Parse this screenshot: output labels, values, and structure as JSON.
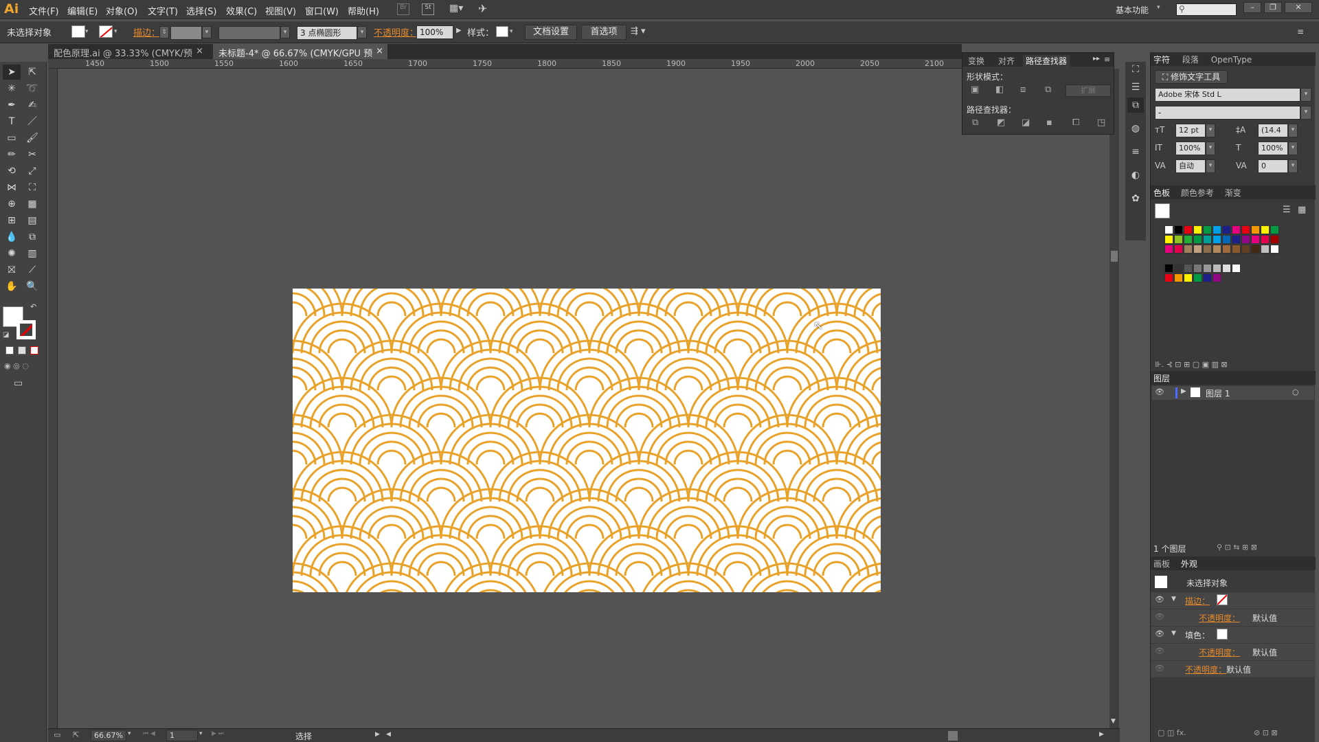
{
  "app": {
    "logo": "Ai"
  },
  "menu": [
    "文件(F)",
    "编辑(E)",
    "对象(O)",
    "文字(T)",
    "选择(S)",
    "效果(C)",
    "视图(V)",
    "窗口(W)",
    "帮助(H)"
  ],
  "menu_right": {
    "workspace": "基本功能",
    "search_placeholder": ""
  },
  "window_buttons": [
    "–",
    "❐",
    "✕"
  ],
  "control": {
    "selection": "未选择对象",
    "stroke_label": "描边：",
    "stroke_weight": "",
    "brush": "3 点椭圆形",
    "opacity_label": "不透明度：",
    "opacity_value": "100%",
    "style_label": "样式：",
    "doc_setup": "文档设置",
    "preferences": "首选项"
  },
  "tabs": [
    {
      "label": "配色原理.ai @ 33.33% (CMYK/预览)",
      "close": "×"
    },
    {
      "label": "未标题-4* @ 66.67% (CMYK/GPU 预览)",
      "close": "×"
    }
  ],
  "ruler": [
    "1450",
    "1500",
    "1550",
    "1600",
    "1650",
    "1700",
    "1750",
    "1800",
    "1850",
    "1900",
    "1950",
    "2000",
    "2050",
    "2100"
  ],
  "pathfinder": {
    "tabs": [
      "变换",
      "对齐",
      "路径查找器"
    ],
    "shape_modes": "形状模式：",
    "expand": "扩展",
    "pathfinders": "路径查找器："
  },
  "char_panel": {
    "tabs": [
      "字符",
      "段落",
      "OpenType"
    ],
    "touch_tool": "修饰文字工具",
    "font": "Adobe 宋体 Std L",
    "style": "-",
    "size": "12 pt",
    "leading": "(14.4",
    "vscale": "100%",
    "hscale": "100%",
    "kerning": "自动",
    "tracking": "0"
  },
  "swatch_panel": {
    "tabs": [
      "色板",
      "颜色参考",
      "渐变"
    ],
    "row1": [
      "#ffffff",
      "#000000",
      "#e60012",
      "#fff100",
      "#009944",
      "#00a0e9",
      "#1d2088",
      "#e4007f",
      "#e60012",
      "#f39800",
      "#fff100",
      "#009944"
    ],
    "row2": [
      "#fff100",
      "#8fc31f",
      "#22ac38",
      "#009944",
      "#009e96",
      "#00a0e9",
      "#0068b7",
      "#1d2088",
      "#920783",
      "#e4007f",
      "#e5004f",
      "#a40000"
    ],
    "row3": [
      "#e4007f",
      "#e5004f",
      "#a0805c",
      "#c0a080",
      "#8b6c4b",
      "#b08a5a",
      "#a06a3c",
      "#8a5a2c",
      "#604020",
      "#402a14",
      "#c0c0c0",
      "#ffffff"
    ],
    "row5": [
      "#000000",
      "#333333",
      "#555555",
      "#777777",
      "#999999",
      "#bbbbbb",
      "#dddddd",
      "#ffffff"
    ],
    "row6": [
      "#e60012",
      "#f39800",
      "#fff100",
      "#009944",
      "#1d2088",
      "#920783"
    ]
  },
  "layers_panel": {
    "title": "图层",
    "layer_name": "图层 1",
    "count": "1 个图层"
  },
  "appearance_panel": {
    "tabs": [
      "画板",
      "外观"
    ],
    "object": "未选择对象",
    "stroke": "描边：",
    "opacity1": "不透明度：",
    "default1": "默认值",
    "fill": "填色：",
    "opacity2": "不透明度：",
    "default2": "默认值",
    "opacity3": "不透明度：",
    "default3": "默认值"
  },
  "status": {
    "zoom": "66.67%",
    "page": "1",
    "mode": "选择"
  },
  "pattern": {
    "color": "#e8a22a"
  }
}
